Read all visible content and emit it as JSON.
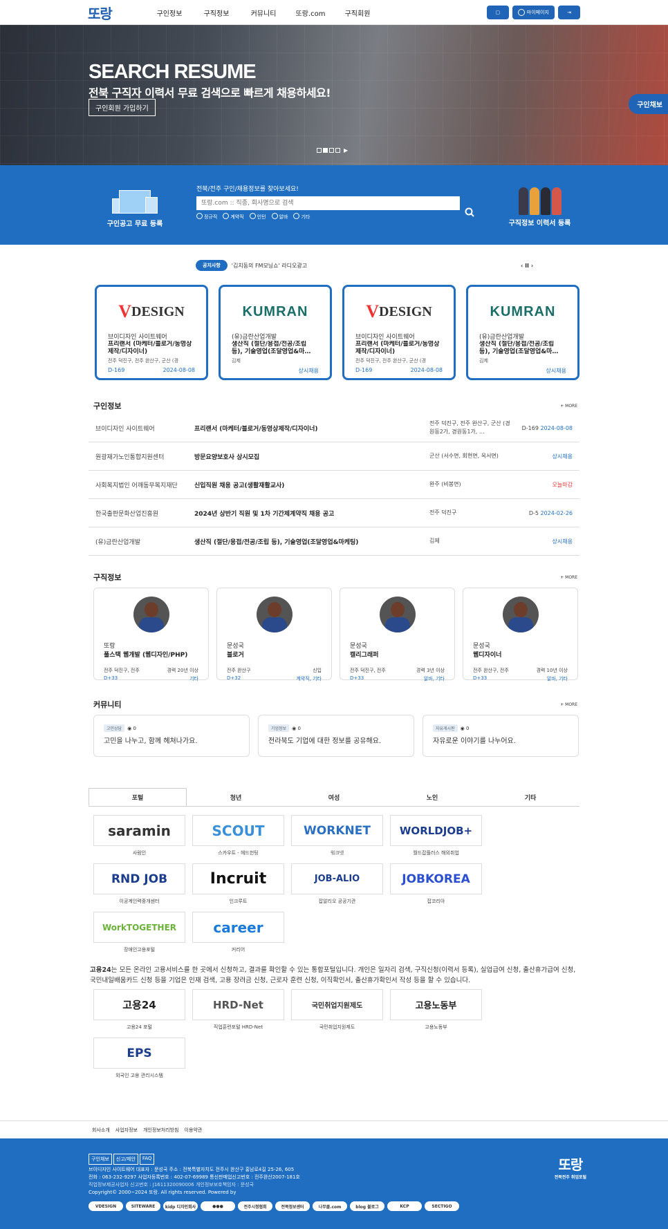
{
  "header": {
    "logo": "또랑",
    "nav": [
      "구인정보",
      "구직정보",
      "커뮤니티",
      "또랑.com",
      "구직회원"
    ],
    "btn_chat": "▢",
    "btn_mypage": "마이페이지",
    "btn_logout": "⇥"
  },
  "hero": {
    "title": "SEARCH RESUME",
    "subtitle": "전북 구직자 이력서 무료 검색으로 빠르게 채용하세요!",
    "cta": "구인회원 가입하기",
    "side_tab": "구인채보"
  },
  "search": {
    "left_label": "구인공고 무료 등록",
    "heading": "전북/전주 구인/채용정보를 찾아보세요!",
    "placeholder": "또랑.com :: 직종, 회사명으로 검색",
    "radios": [
      "정규직",
      "계약직",
      "인턴",
      "알바",
      "기타"
    ],
    "right_label": "구직정보 이력서 등록"
  },
  "notice": {
    "badge": "공지사항",
    "text": "'김치동의 FM모닝쇼' 라디오광고",
    "controls": "‹ II ›"
  },
  "featured": [
    {
      "logo": "DESIGN",
      "company": "브이디자인 사이트웨어",
      "title": "프리랜서 (마케터/블로거/동영상제작/디자이너)",
      "location": "전주 덕진구, 전주 완산구, 군산 (경",
      "d": "D-169",
      "date": "2024-08-08"
    },
    {
      "logo": "KUMRAN",
      "company": "(유)금란산업개발",
      "title": "생산직 (절단/용접/전공/조립 등), 기술영업(조달영업&마…",
      "location": "김제",
      "d": "",
      "date": "상시채용"
    },
    {
      "logo": "DESIGN",
      "company": "브이디자인 사이트웨어",
      "title": "프리랜서 (마케터/블로거/동영상제작/디자이너)",
      "location": "전주 덕진구, 전주 완산구, 군산 (경",
      "d": "D-169",
      "date": "2024-08-08"
    },
    {
      "logo": "KUMRAN",
      "company": "(유)금란산업개발",
      "title": "생산직 (절단/용접/전공/조립 등), 기술영업(조달영업&마…",
      "location": "김제",
      "d": "",
      "date": "상시채용"
    }
  ],
  "jobs": {
    "title": "구인정보",
    "more": "+ MORE",
    "rows": [
      {
        "company": "브이디자인 사이트웨어",
        "title": "프리랜서 (마케터/블로거/동영상제작/디자이너)",
        "location": "전주 덕진구, 전주 완산구, 군산 (경원동2가, 경원동1가, …",
        "d": "D-169",
        "date": "2024-08-08"
      },
      {
        "company": "원광재가노인통합지원센터",
        "title": "방문요양보호사 상시모집",
        "location": "군산 (서수면, 회현면, 옥서면)",
        "d": "",
        "date": "상시채용"
      },
      {
        "company": "사회복지법인 어깨동무복지재단",
        "title": "신입직원 채용 공고(생활재활교사)",
        "location": "완주 (비봉면)",
        "d": "",
        "date": "오늘마감"
      },
      {
        "company": "한국출판문화산업진흥원",
        "title": "2024년 상반기 직원 및 1차 기간제계약직 채용 공고",
        "location": "전주 덕진구",
        "d": "D-5",
        "date": "2024-02-26"
      },
      {
        "company": "(유)금란산업개발",
        "title": "생산직 (절단/용접/전공/조립 등), 기술영업(조달영업&마케팅)",
        "location": "김제",
        "d": "",
        "date": "상시채용"
      }
    ]
  },
  "resumes": {
    "title": "구직정보",
    "more": "+ MORE",
    "items": [
      {
        "name": "또랑",
        "title": "풀스택 웹개발 (웹디자인/PHP)",
        "location": "전주 덕진구, 전주",
        "career": "경력 20년 이상",
        "d": "D+33",
        "type": "기타"
      },
      {
        "name": "문성국",
        "title": "블로거",
        "location": "전주 완산구",
        "career": "신입",
        "d": "D+32",
        "type": "계약직, 기타"
      },
      {
        "name": "문성국",
        "title": "캘리그래퍼",
        "location": "전주 덕진구, 전주",
        "career": "경력 3년 이상",
        "d": "D+33",
        "type": "알바, 기타"
      },
      {
        "name": "문성국",
        "title": "웹디자이너",
        "location": "전주 완산구, 전주",
        "career": "경력 10년 이상",
        "d": "D+33",
        "type": "알바, 기타"
      }
    ]
  },
  "community": {
    "title": "커뮤니티",
    "more": "+ MORE",
    "items": [
      {
        "badge": "고민상담",
        "views": "0",
        "text": "고민을 나누고, 함께 헤쳐나가요."
      },
      {
        "badge": "기업정보",
        "views": "0",
        "text": "전라북도 기업에 대한 정보를 공유해요."
      },
      {
        "badge": "자유게시판",
        "views": "0",
        "text": "자유로운 이야기를 나누어요."
      }
    ]
  },
  "portal": {
    "tabs": [
      "포털",
      "청년",
      "여성",
      "노인",
      "기타"
    ],
    "items": [
      {
        "logo": "saramin",
        "caption": "사람인",
        "color": "#333"
      },
      {
        "logo": "SCOUT",
        "caption": "스카우트 - 헤드헌팅",
        "color": "#3a8fd9"
      },
      {
        "logo": "WORKNET",
        "caption": "워크넷",
        "color": "#2a6fc2"
      },
      {
        "logo": "WORLDJOB+",
        "caption": "월드잡플러스 해외취업",
        "color": "#1c3d8c"
      },
      {
        "logo": "RND JOB",
        "caption": "이공계인력중개센터",
        "color": "#1c3d8c"
      },
      {
        "logo": "Incruit",
        "caption": "인크루트",
        "color": "#111"
      },
      {
        "logo": "JOB-ALIO",
        "caption": "잡알리오 공공기관",
        "color": "#1c3d8c"
      },
      {
        "logo": "JOBKOREA",
        "caption": "잡코리아",
        "color": "#2a4fd0"
      },
      {
        "logo": "WorkTOGETHER",
        "caption": "장애인고용포털",
        "color": "#6ab23a"
      },
      {
        "logo": "career",
        "caption": "커리어",
        "color": "#1a7ad9"
      }
    ]
  },
  "desc": {
    "strong": "고용24",
    "text": "는 모든 온라인 고용서비스를 한 곳에서 신청하고, 결과를 확인할 수 있는 통합포털입니다. 개인은 일자리 검색, 구직신청(이력서 등록), 실업급여 신청, 출산휴가급여 신청, 국민내일배움카드 신청 등을 기업은 인재 검색, 고용 장려금 신청, 근로자 훈련 신청, 이직확인서, 출산휴가확인서 작성 등을 할 수 있습니다."
  },
  "gov": [
    {
      "logo": "고용24",
      "caption": "고용24 포털",
      "color": "#222"
    },
    {
      "logo": "HRD-Net",
      "caption": "직업훈련포털 HRD-Net",
      "color": "#555"
    },
    {
      "logo": "국민취업지원제도",
      "caption": "국민취업지원제도",
      "color": "#333"
    },
    {
      "logo": "고용노동부",
      "caption": "고용노동부",
      "color": "#222"
    },
    {
      "logo": "EPS",
      "caption": "외국인 고용 관리시스템",
      "color": "#1c3d8c"
    }
  ],
  "footer": {
    "links": [
      "회사소개",
      "사업자정보",
      "개인정보처리방침",
      "이용약관"
    ],
    "btns": [
      "구인채보",
      "신고/제안",
      "FAQ"
    ],
    "line1": "브이디자인 사이트웨어   대표자 : 문성국   주소 : 전북특별자치도 전주시 완산구 홍남로4길 25-26, 605",
    "line2": "전화 : 063-232-9297   사업자등록번호 : 402-07-69989  통신판매업신고번호 : 전주완산2007-181호",
    "line3": "직업정보제공사업자 신고번호 : J1611320090006   개인정보보호책임자 : 문성국",
    "line4": "Copyright© 2000~2024 또랑. All rights reserved. Powered by",
    "partners": [
      "VDESIGN",
      "SITEWARE",
      "kidp 디자인회사",
      "●●●",
      "전주시청협회",
      "전북정보센터",
      "나무클.com",
      "blog 블로그",
      "KCP",
      "SECTIGO"
    ],
    "logo": "또랑",
    "logo_sub": "전북전주 취업포털"
  }
}
